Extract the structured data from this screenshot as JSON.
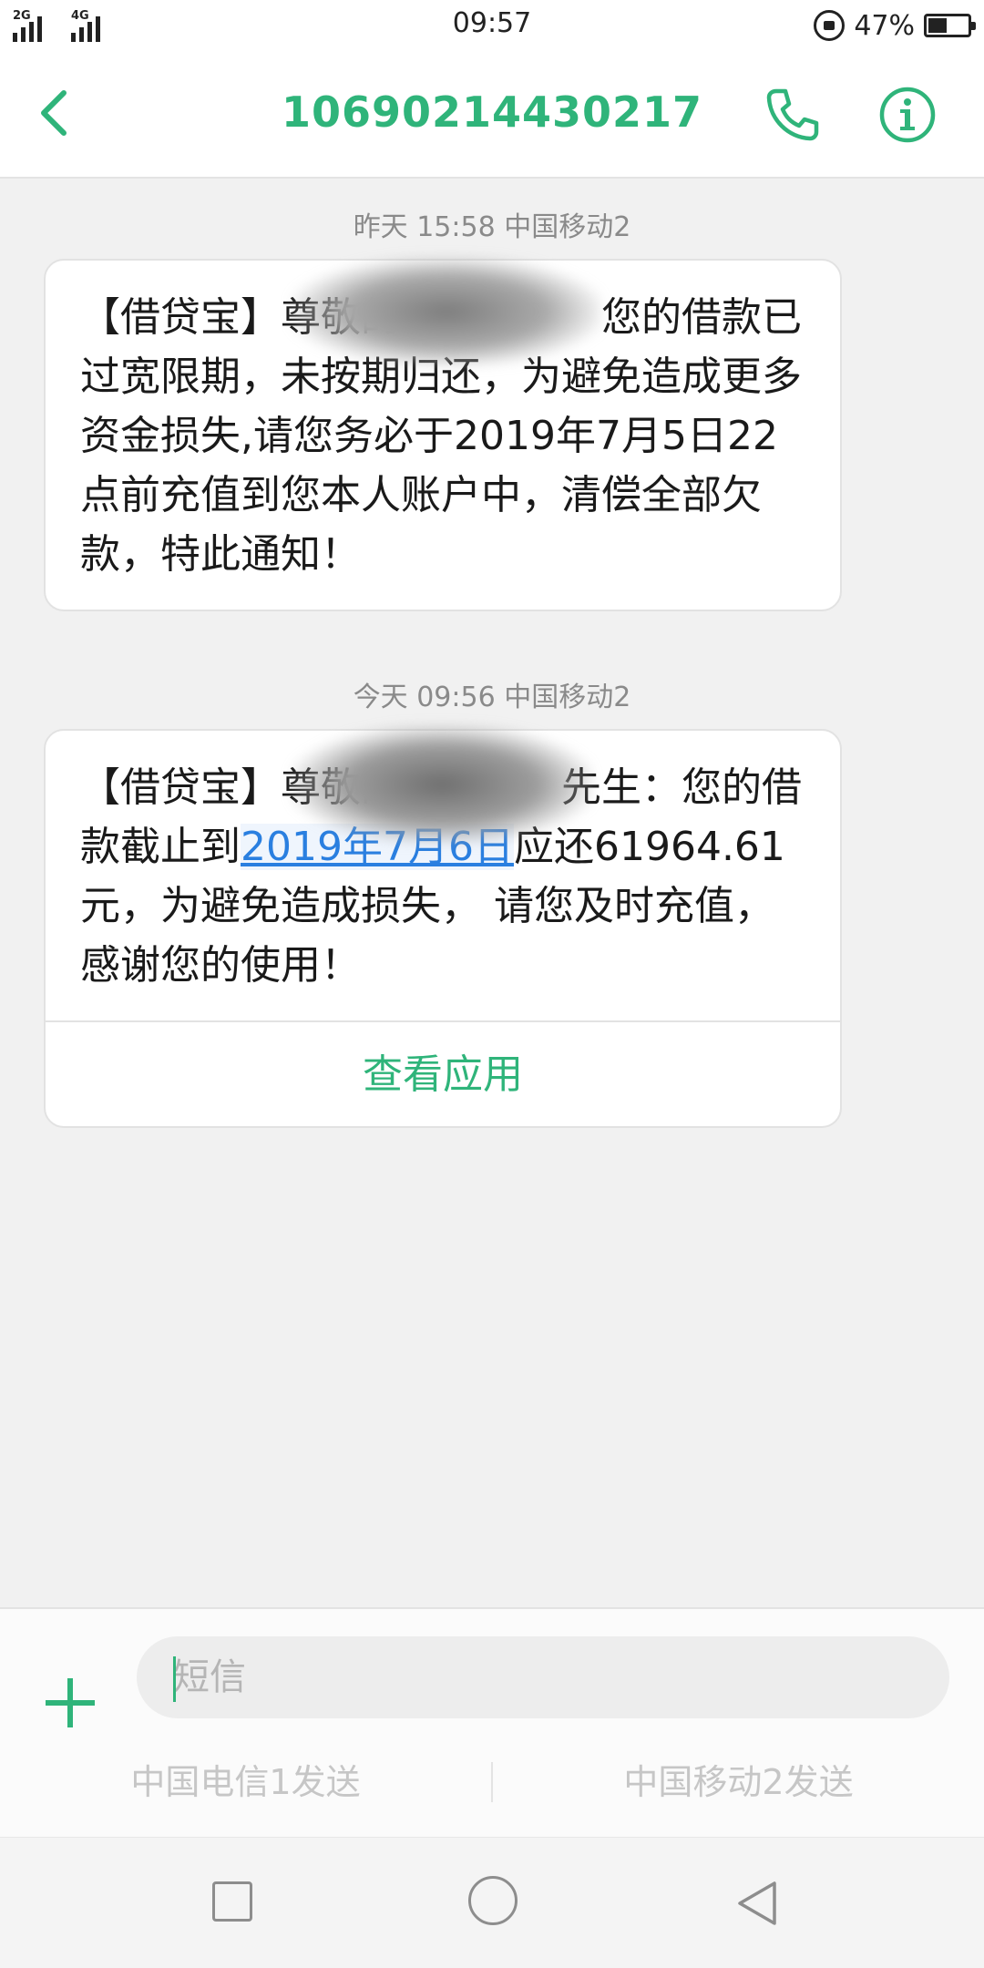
{
  "status_bar": {
    "sim1_tag": "2G",
    "sim2_tag": "4G",
    "time": "09:57",
    "battery_percent": "47%",
    "battery_level": 0.47,
    "rotation_lock_icon": "rotation-lock-icon"
  },
  "header": {
    "back_icon": "chevron-left-icon",
    "title": "10690214430217",
    "call_icon": "phone-icon",
    "info_icon": "info-icon",
    "accent_color": "#2fb47a"
  },
  "messages": [
    {
      "meta": "昨天 15:58  中国移动2",
      "text": "【借贷宝】尊敬的　　　　　您的借款已过宽限期，未按期归还，为避免造成更多资金损失,请您务必于2019年7月5日22点前充值到您本人账户中，清偿全部欠款，特此通知！"
    },
    {
      "meta": "今天 09:56  中国移动2",
      "text_before": "【借贷宝】尊敬的　　　　先生：您的借款截止到",
      "link": "2019年7月6日",
      "text_after": "应还61964.61元，为避免造成损失， 请您及时充值，感谢您的使用！",
      "action": "查看应用"
    }
  ],
  "composer": {
    "add_icon": "plus-icon",
    "placeholder": "短信",
    "send_sim1": "中国电信1发送",
    "send_sim2": "中国移动2发送"
  },
  "nav_bar": {
    "recent_icon": "square-icon",
    "home_icon": "circle-icon",
    "back_icon": "triangle-back-icon"
  }
}
